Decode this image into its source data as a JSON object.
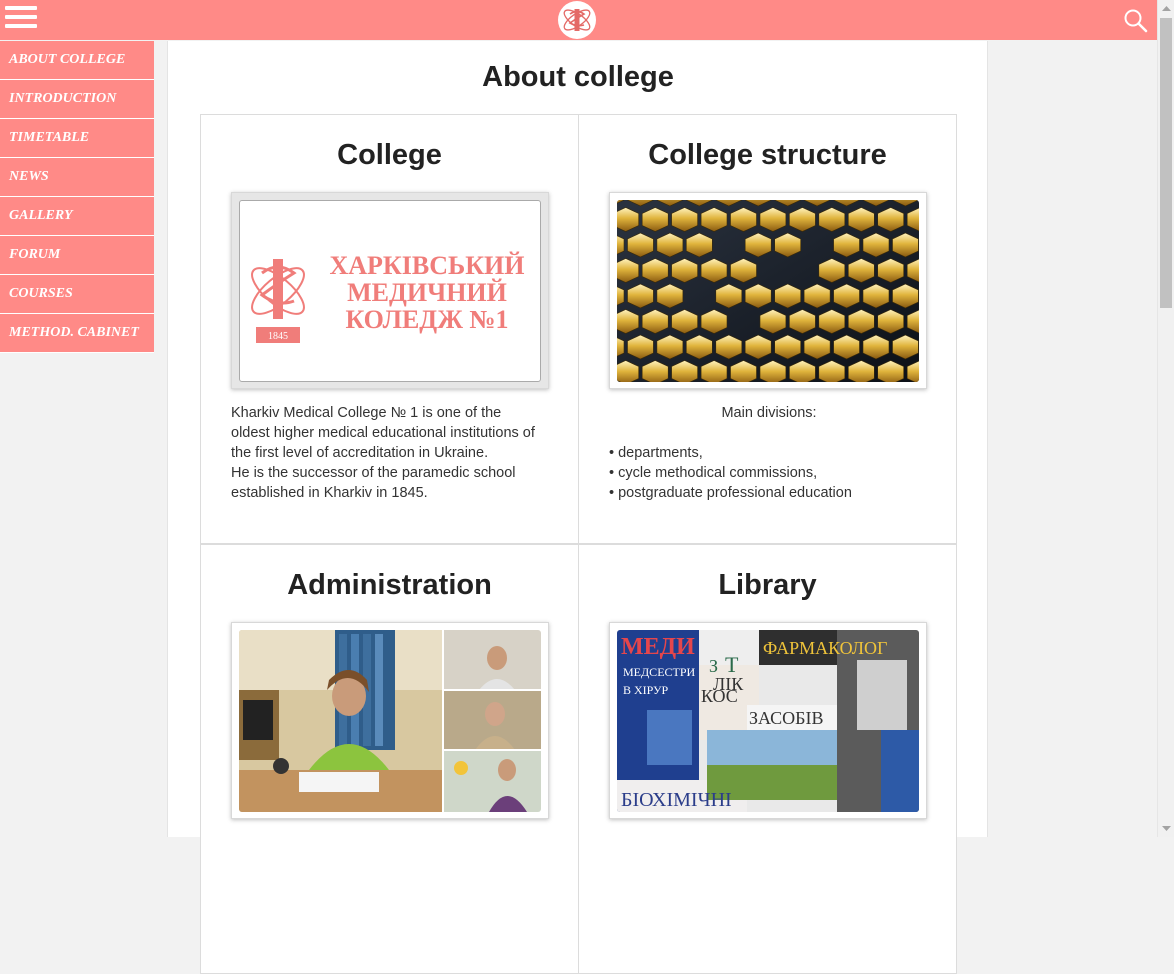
{
  "header": {
    "menu_icon": "hamburger-icon",
    "logo_icon": "college-emblem-icon",
    "search_icon": "search-icon",
    "bar_color": "#ff8a87"
  },
  "sidebar": {
    "items": [
      {
        "label": "ABOUT COLLEGE"
      },
      {
        "label": "INTRODUCTION"
      },
      {
        "label": "TIMETABLE"
      },
      {
        "label": "NEWS"
      },
      {
        "label": "GALLERY"
      },
      {
        "label": "FORUM"
      },
      {
        "label": "COURSES"
      },
      {
        "label": "METHOD. CABINET"
      }
    ]
  },
  "main": {
    "title": "About college",
    "cards": [
      {
        "title": "College",
        "logo": {
          "line1": "ХАРКІВСЬКИЙ",
          "line2": "МЕДИЧНИЙ",
          "line3": "КОЛЕДЖ №1",
          "year": "1845"
        },
        "text_lines": [
          "Kharkiv Medical College № 1 is one of the",
          "oldest higher medical educational institutions of",
          "the first level of accreditation in Ukraine.",
          "He is the successor of the paramedic school",
          "established in Kharkiv in 1845."
        ]
      },
      {
        "title": "College structure",
        "intro": "Main divisions:",
        "bullets": [
          "• departments,",
          "• cycle methodical commissions,",
          "• postgraduate professional education"
        ]
      },
      {
        "title": "Administration"
      },
      {
        "title": "Library",
        "book_titles": [
          "МЕДИ",
          "МЕДСЕСТРИ",
          "В ХІРУР",
          "З",
          "Т",
          "ЛІК",
          "КОС",
          "ФАРМАКОЛОГ",
          "ЗАСОБІВ",
          "БІОХІМІЧНІ"
        ]
      }
    ]
  }
}
